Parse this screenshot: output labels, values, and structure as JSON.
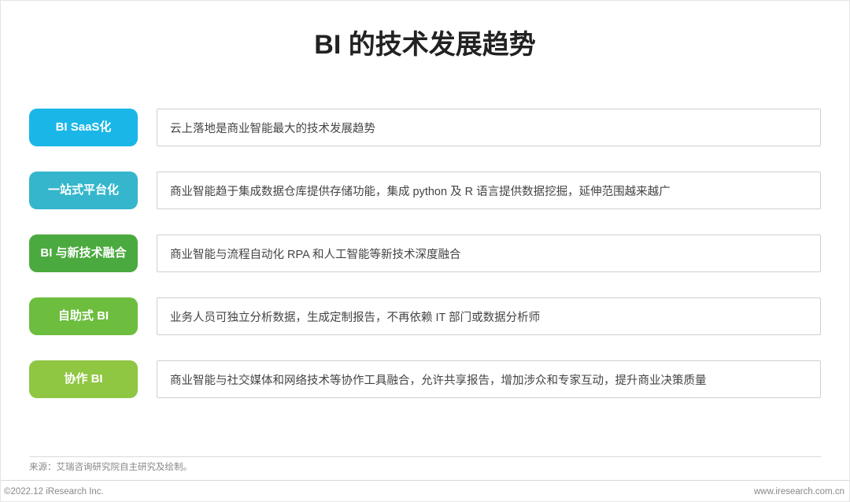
{
  "title": "BI 的技术发展趋势",
  "items": [
    {
      "label": "BI SaaS化",
      "desc": "云上落地是商业智能最大的技术发展趋势",
      "color": "#1AB6E8"
    },
    {
      "label": "一站式平台化",
      "desc": "商业智能趋于集成数据仓库提供存储功能，集成 python 及 R 语言提供数据挖掘，延伸范围越来越广",
      "color": "#35B6CC"
    },
    {
      "label": "BI 与新技术融合",
      "desc": "商业智能与流程自动化 RPA 和人工智能等新技术深度融合",
      "color": "#4BAA3F"
    },
    {
      "label": "自助式 BI",
      "desc": "业务人员可独立分析数据，生成定制报告，不再依赖 IT 部门或数据分析师",
      "color": "#6DBE3F"
    },
    {
      "label": "协作 BI",
      "desc": "商业智能与社交媒体和网络技术等协作工具融合，允许共享报告，增加涉众和专家互动，提升商业决策质量",
      "color": "#8FC642"
    }
  ],
  "source": "来源：艾瑞咨询研究院自主研究及绘制。",
  "copyright": "©2022.12 iResearch Inc.",
  "site": "www.iresearch.com.cn"
}
